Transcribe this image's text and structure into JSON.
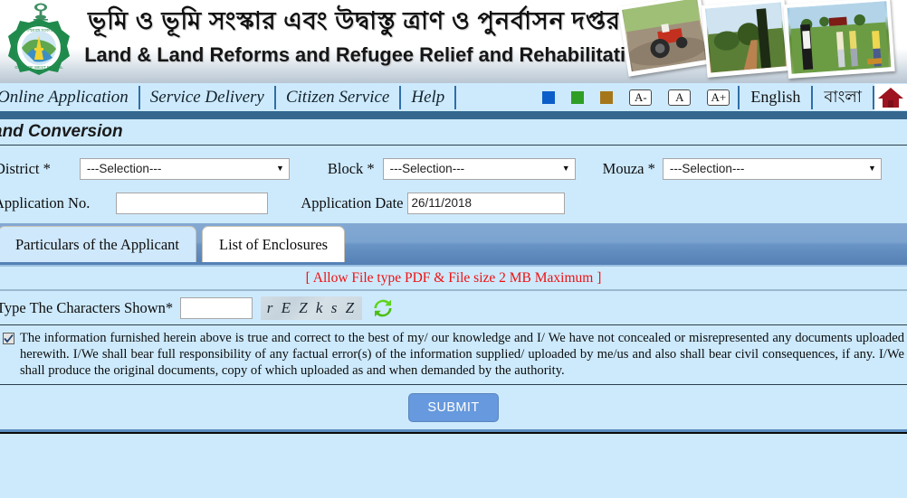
{
  "header": {
    "title_bn": "ভূমি ও ভূমি সংস্কার এবং উদ্বাস্তু ত্রাণ ও পুনর্বাসন দপ্তর",
    "title_en": "Land & Land Reforms and Refugee Relief and Rehabilitation Department",
    "emblem_name": "west-bengal-government-seal"
  },
  "nav": {
    "items": [
      {
        "label": "Online Application"
      },
      {
        "label": "Service Delivery"
      },
      {
        "label": "Citizen Service"
      },
      {
        "label": "Help"
      }
    ],
    "theme_swatches": [
      {
        "name": "theme-blue",
        "color": "#0b5ec9"
      },
      {
        "name": "theme-green",
        "color": "#2f9e25"
      },
      {
        "name": "theme-brown",
        "color": "#a5771a"
      }
    ],
    "font_sizes": [
      {
        "label": "A-",
        "name": "font-decrease"
      },
      {
        "label": "A",
        "name": "font-normal"
      },
      {
        "label": "A+",
        "name": "font-increase"
      }
    ],
    "lang_english": "English",
    "lang_bangla": "বাংলা",
    "home_icon": "home-icon"
  },
  "page": {
    "title": "and Conversion"
  },
  "form": {
    "district_label": "District *",
    "district_value": "---Selection---",
    "block_label": "Block *",
    "block_value": "---Selection---",
    "mouza_label": "Mouza *",
    "mouza_value": "---Selection---",
    "application_no_label": "Application No.",
    "application_no_value": "",
    "application_date_label": "Application Date",
    "application_date_value": "26/11/2018"
  },
  "tabs": [
    {
      "label": "Particulars of the Applicant",
      "state": "active"
    },
    {
      "label": "List of Enclosures",
      "state": "inactive"
    }
  ],
  "notice": {
    "text": "[ Allow File type PDF & File size 2 MB Maximum ]",
    "color": "#f01010"
  },
  "captcha": {
    "label": "Type The Characters Shown*",
    "input_value": "",
    "challenge_text": "r E Z k s Z",
    "refresh_icon": "refresh-icon"
  },
  "declaration": {
    "checked": true,
    "text": "The information furnished herein above is true and correct to the best of my/ our knowledge and I/ We have not concealed or misrepresented any documents uploaded herewith. I/We shall bear full responsibility of any factual error(s) of the information supplied/ uploaded by me/us and also shall bear civil consequences, if any. I/We shall produce the original documents, copy of which uploaded as and when demanded by the authority."
  },
  "submit": {
    "label": "SUBMIT"
  }
}
